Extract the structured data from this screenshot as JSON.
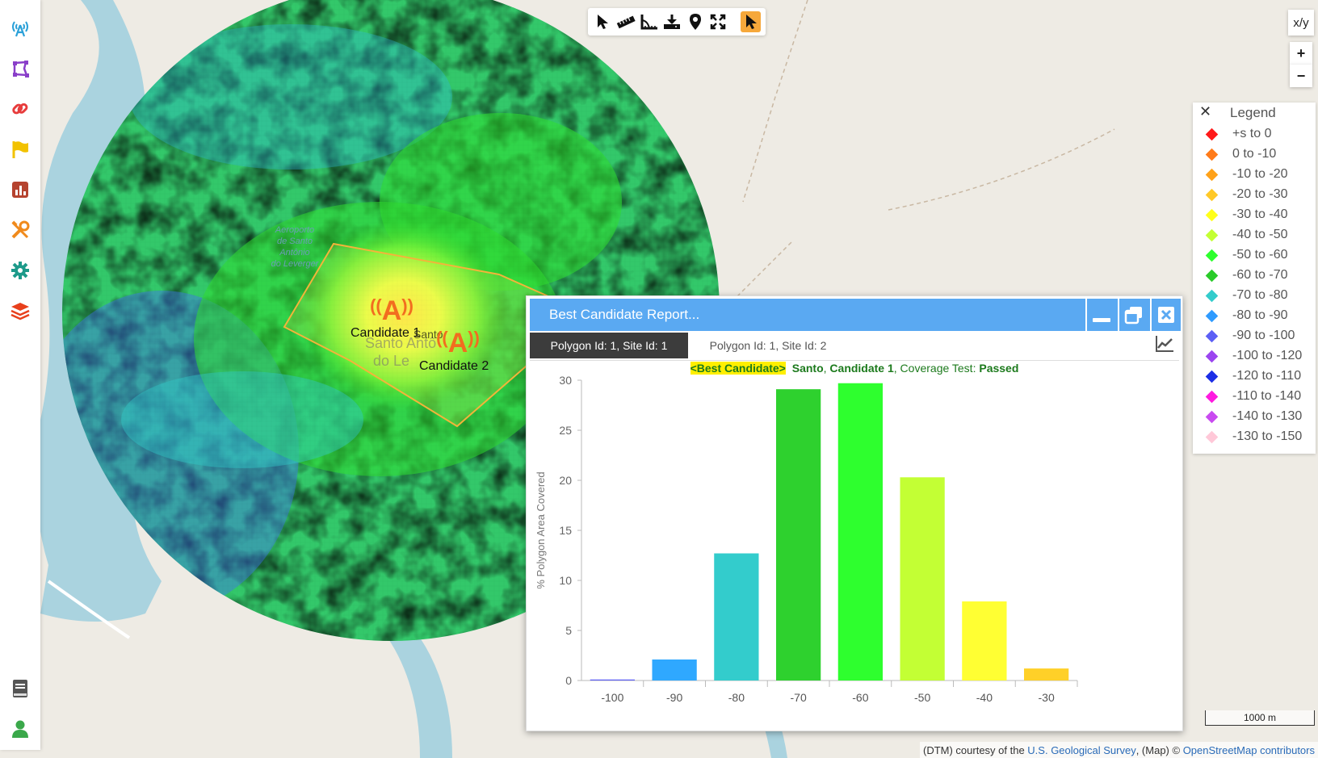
{
  "toolbar": {
    "tools": [
      "select-tool",
      "measure-ruler-tool",
      "measure-angle-tool",
      "download-tool",
      "marker-tool",
      "fullscreen-tool",
      "pointer-active-tool"
    ]
  },
  "controls": {
    "xy_label": "x/y",
    "zoom_in": "+",
    "zoom_out": "−"
  },
  "legend": {
    "close": "✕",
    "title": "Legend",
    "items": [
      {
        "label": "+s to 0",
        "color": "#ff1a1a"
      },
      {
        "label": "0 to -10",
        "color": "#ff7b1a"
      },
      {
        "label": "-10 to -20",
        "color": "#ffa21a"
      },
      {
        "label": "-20 to -30",
        "color": "#ffc928"
      },
      {
        "label": "-30 to -40",
        "color": "#ffff1a"
      },
      {
        "label": "-40 to -50",
        "color": "#c3ff34"
      },
      {
        "label": "-50 to -60",
        "color": "#2eff2e"
      },
      {
        "label": "-60 to -70",
        "color": "#2acb2a"
      },
      {
        "label": "-70 to -80",
        "color": "#33cccc"
      },
      {
        "label": "-80 to -90",
        "color": "#2f9bff"
      },
      {
        "label": "-90 to -100",
        "color": "#5c5ff5"
      },
      {
        "label": "-100 to -120",
        "color": "#9b45f0"
      },
      {
        "label": "-120 to -110",
        "color": "#1c2ee6"
      },
      {
        "label": "-110 to -140",
        "color": "#ff1ae0"
      },
      {
        "label": "-140 to -130",
        "color": "#c94af0"
      },
      {
        "label": "-130 to -150",
        "color": "#ffc8d8"
      }
    ]
  },
  "map": {
    "candidate1": "Candidate 1",
    "candidate2": "Candidate 2",
    "place_overlap": "Santo",
    "airport": [
      "Aeroporto",
      "de Santo",
      "Antônio",
      "do Leverger"
    ],
    "town": [
      "Santo Antô",
      "do Le"
    ]
  },
  "report": {
    "title": "Best Candidate Report...",
    "tabs": [
      "Polygon Id: 1, Site Id: 1",
      "Polygon Id: 1, Site Id: 2"
    ],
    "status": {
      "badge": "<Best Candidate>",
      "site": "Santo",
      "sep1": ", ",
      "candidate": "Candidate 1",
      "sep2": ", Coverage Test: ",
      "result": "Passed"
    }
  },
  "chart_data": {
    "type": "bar",
    "ylabel": "% Polygon Area Covered",
    "xlabel": "",
    "categories": [
      "-100",
      "-90",
      "-80",
      "-70",
      "-60",
      "-50",
      "-40",
      "-30"
    ],
    "values": [
      0.1,
      2.1,
      12.7,
      29.1,
      29.7,
      20.3,
      7.9,
      1.2
    ],
    "colors": [
      "#5c5ff5",
      "#2fa8ff",
      "#33cccc",
      "#2ed12e",
      "#2eff2e",
      "#c3ff34",
      "#ffff33",
      "#ffd028"
    ],
    "ylim": [
      0,
      30
    ],
    "yticks": [
      0,
      5,
      10,
      15,
      20,
      25,
      30
    ],
    "grid": false
  },
  "scale": "1000 m",
  "attribution": {
    "prefix": "(DTM) courtesy of the ",
    "usgs": "U.S. Geological Survey",
    "mid": ", (Map) © ",
    "osm": "OpenStreetMap contributors"
  }
}
